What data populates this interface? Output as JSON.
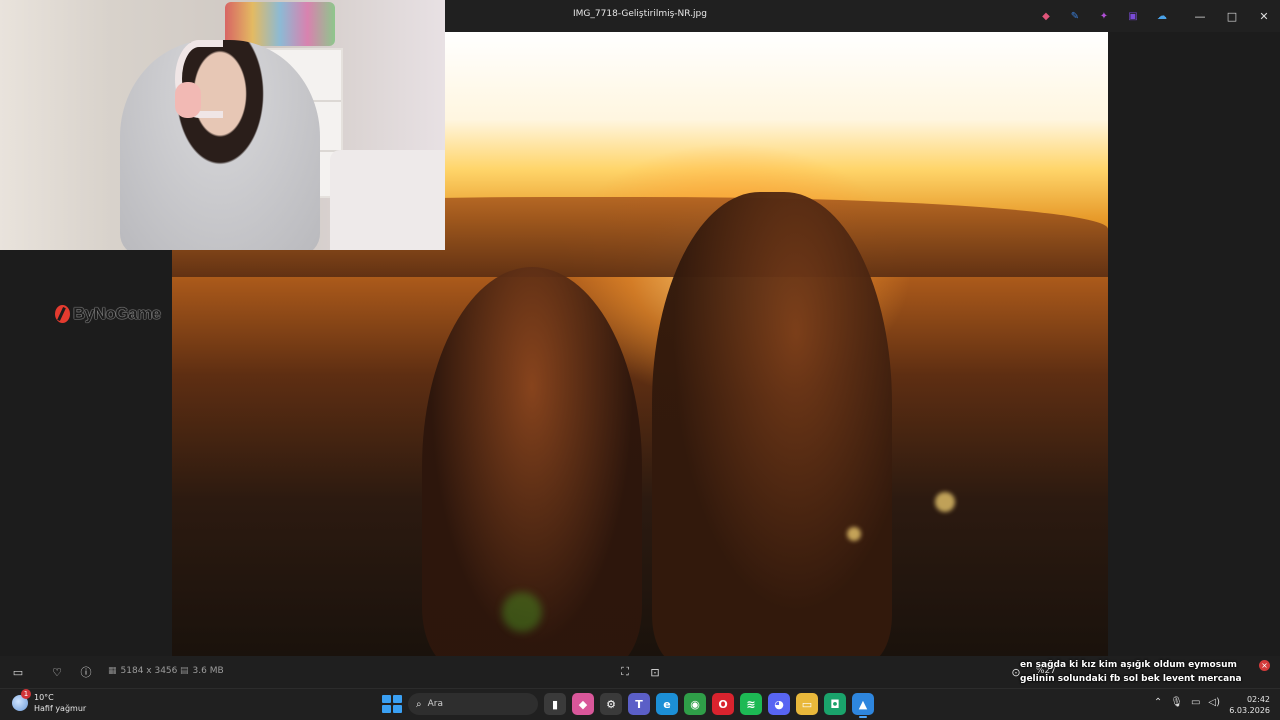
{
  "window": {
    "title": "IMG_7718-Geliştirilmiş-NR.jpg",
    "controls": {
      "minimize": "—",
      "maximize": "□",
      "close": "✕"
    }
  },
  "toolbar": {
    "tools": [
      {
        "name": "copilot-icon",
        "glyph": "◆",
        "color": "#e0557a"
      },
      {
        "name": "edit-icon",
        "glyph": "✎",
        "color": "#3b7fd9"
      },
      {
        "name": "effects-icon",
        "glyph": "✦",
        "color": "#b04fd6"
      },
      {
        "name": "clipchamp-icon",
        "glyph": "▣",
        "color": "#7a4bd8"
      },
      {
        "name": "onedrive-icon",
        "glyph": "☁",
        "color": "#4aa2e8"
      }
    ]
  },
  "watermark": {
    "text": "ByNoGame"
  },
  "infobar": {
    "dimensions": "5184 x 3456",
    "filesize": "3.6 MB",
    "zoom": "%27"
  },
  "chat": [
    {
      "user": "",
      "user_color": "#c44b73",
      "message": "en sağda ki kız kim aşığık oldum eymosum"
    },
    {
      "user": "",
      "user_color": "#c44b73",
      "message": "gelinin solundaki fb sol bek levent mercana"
    },
    {
      "user": "",
      "user_color": "#7fb069",
      "message": ""
    }
  ],
  "weather": {
    "temp": "10°C",
    "condition": "Hafif yağmur",
    "badge": "1"
  },
  "taskbar": {
    "search_placeholder": "Ara",
    "apps": [
      {
        "name": "terminal-icon",
        "glyph": "▮",
        "color": "#3a3a3a"
      },
      {
        "name": "copilot-app-icon",
        "glyph": "◆",
        "color": "#d9579a"
      },
      {
        "name": "settings-icon",
        "glyph": "⚙",
        "color": "#3a3a3a"
      },
      {
        "name": "teams-icon",
        "glyph": "T",
        "color": "#5b5fc7"
      },
      {
        "name": "edge-icon",
        "glyph": "e",
        "color": "#1c8fd6"
      },
      {
        "name": "chrome-icon",
        "glyph": "◉",
        "color": "#2f9e48"
      },
      {
        "name": "opera-icon",
        "glyph": "O",
        "color": "#d9232e"
      },
      {
        "name": "spotify-icon",
        "glyph": "≋",
        "color": "#1db954"
      },
      {
        "name": "discord-icon",
        "glyph": "◕",
        "color": "#5865f2"
      },
      {
        "name": "explorer-icon",
        "glyph": "▭",
        "color": "#e9b83b"
      },
      {
        "name": "app-green-icon",
        "glyph": "◘",
        "color": "#1aa36b"
      },
      {
        "name": "photos-icon",
        "glyph": "▲",
        "color": "#2e86de"
      }
    ]
  },
  "clock": {
    "time": "02:42",
    "date": "6.03.2026"
  }
}
